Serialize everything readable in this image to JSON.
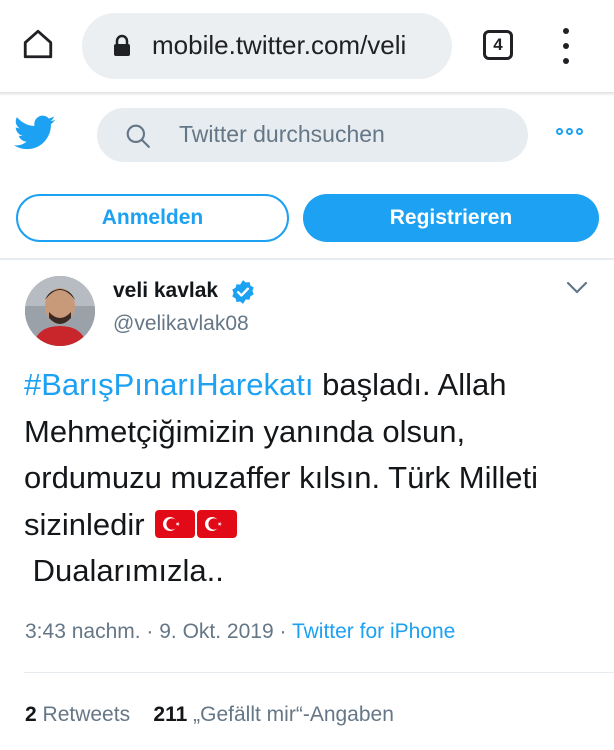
{
  "browser": {
    "url": "mobile.twitter.com/veli",
    "tab_count": "4"
  },
  "header": {
    "search_placeholder": "Twitter durchsuchen",
    "login_label": "Anmelden",
    "signup_label": "Registrieren"
  },
  "tweet": {
    "user_name": "veli kavlak",
    "user_handle": "@velikavlak08",
    "hashtag": "#BarışPınarıHarekatı",
    "text_after_hashtag": " başladı. Allah Mehmetçiğimizin yanında olsun, ordumuzu muzaffer kılsın. Türk Milleti sizinledir",
    "text_end": "Dualarımızla..",
    "flag_icon": "turkey-flag-icon",
    "time": "3:43 nachm.",
    "date": "9. Okt. 2019",
    "separator": " · ",
    "source": "Twitter for iPhone",
    "retweet_count": "2",
    "retweet_label": "Retweets",
    "like_count": "211",
    "like_label": "„Gefällt mir“-Angaben"
  },
  "colors": {
    "accent": "#1da1f2",
    "muted_text": "#657786",
    "flag_red": "#e30a17"
  }
}
